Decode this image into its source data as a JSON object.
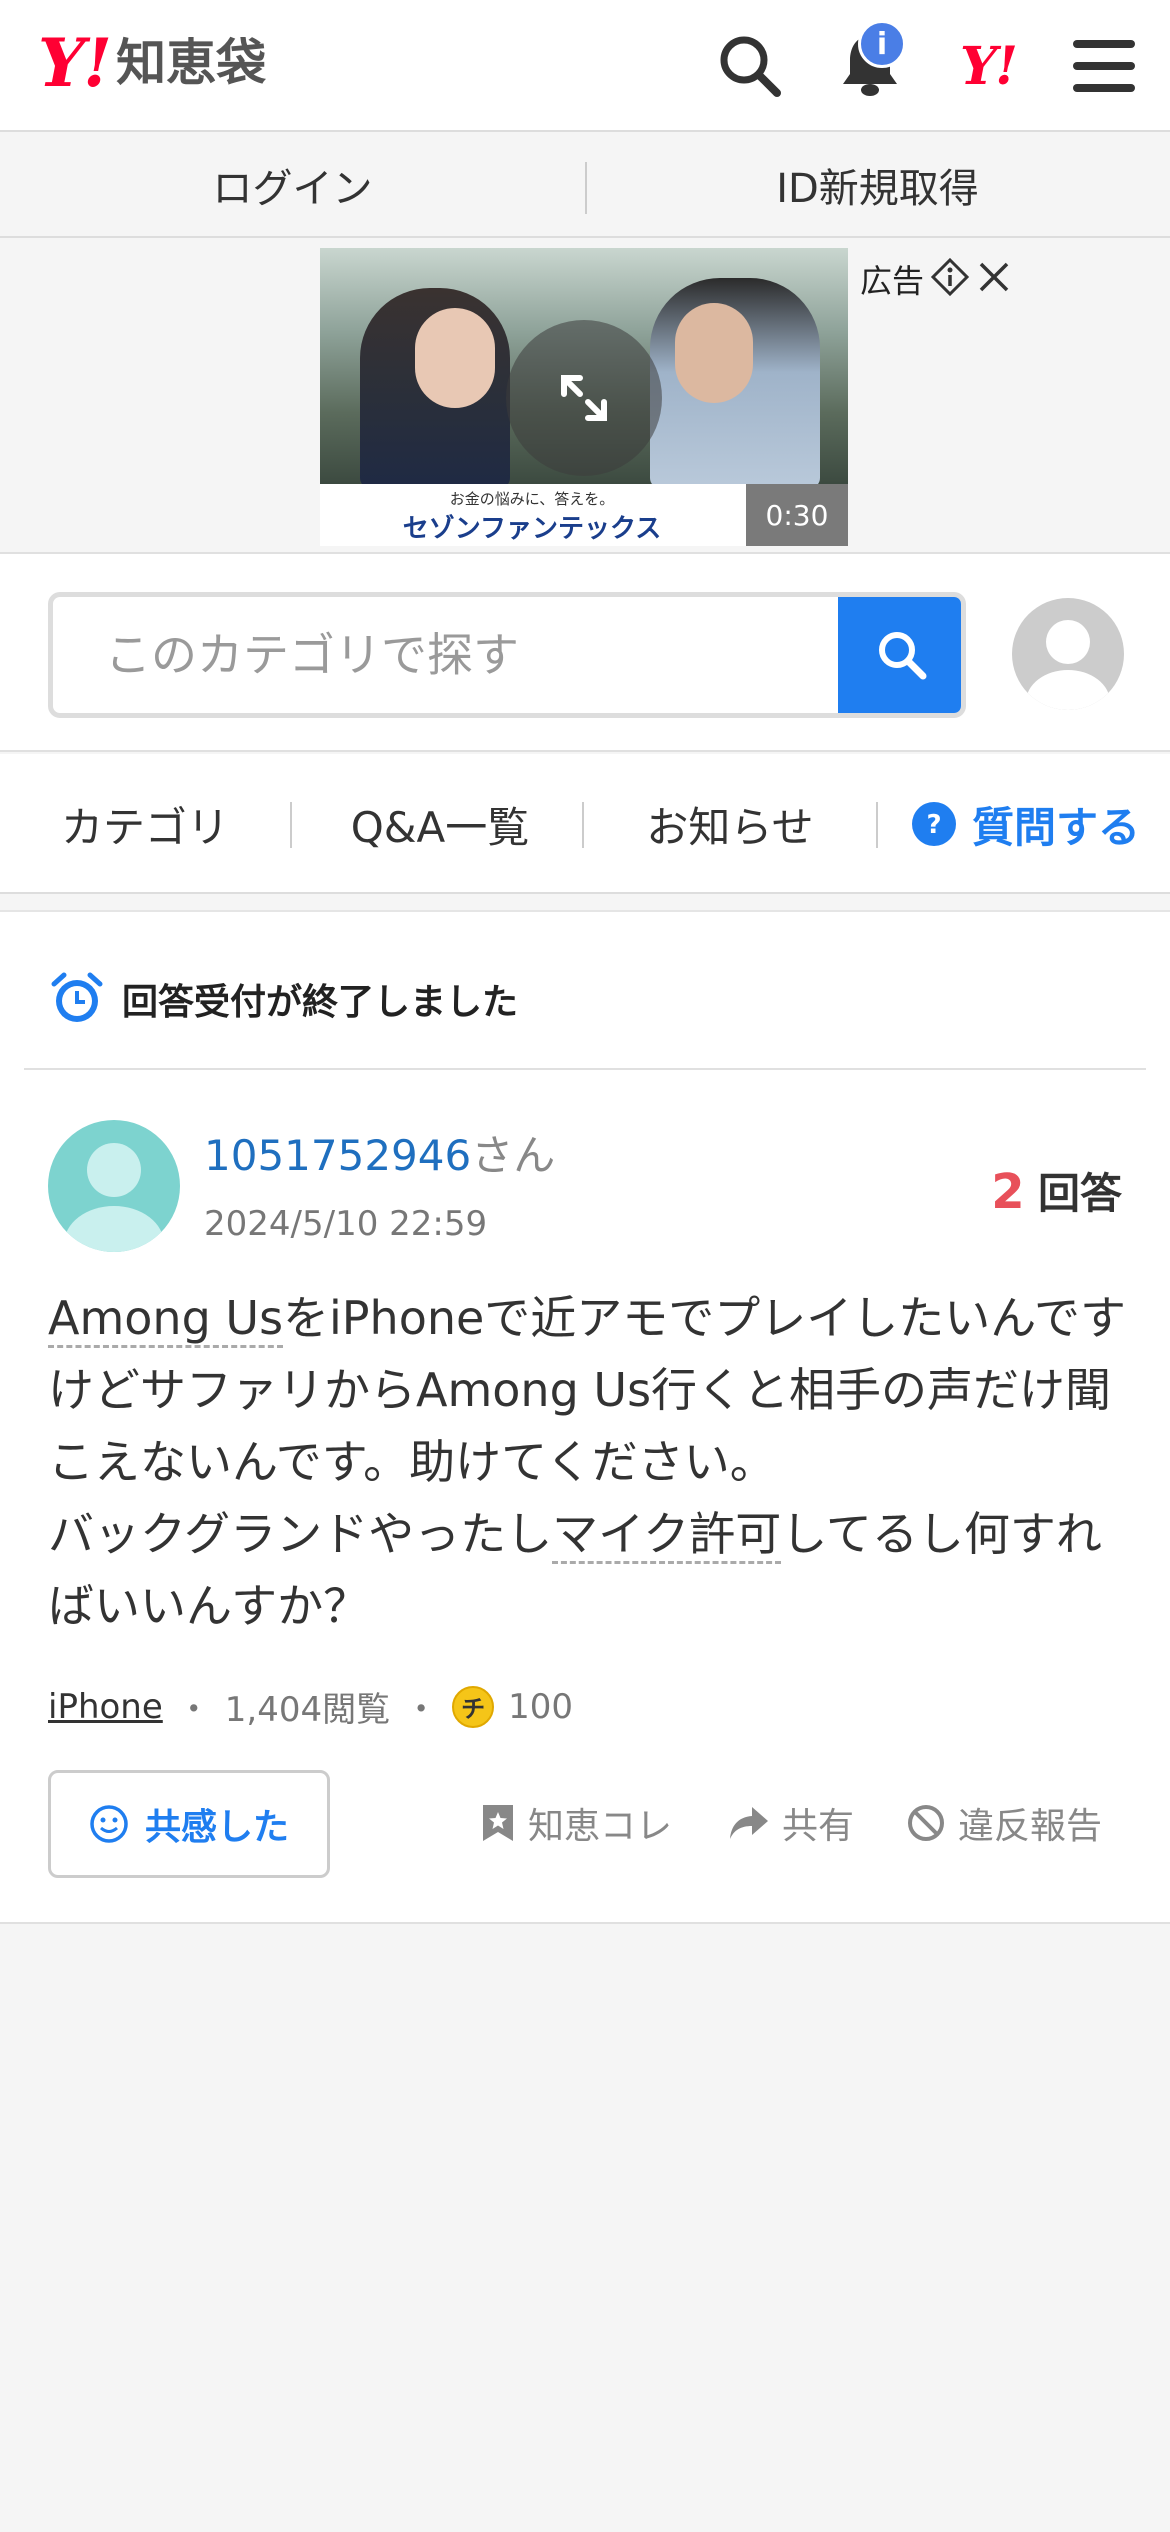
{
  "header": {
    "logo_mark": "Y!",
    "logo_text": "知恵袋",
    "notification_badge": "i",
    "yj_mark": "Y!"
  },
  "login_bar": {
    "login": "ログイン",
    "signup": "ID新規取得"
  },
  "ad": {
    "label": "広告",
    "duration": "0:30",
    "tagline": "お金の悩みに、答えを。",
    "brand": "セゾンファンテックス"
  },
  "search": {
    "placeholder": "このカテゴリで探す"
  },
  "nav": {
    "category": "カテゴリ",
    "qa_list": "Q&A一覧",
    "news": "お知らせ",
    "ask": "質問する"
  },
  "question": {
    "status": "回答受付が終了しました",
    "user_id": "1051752946",
    "user_suffix": "さん",
    "date": "2024/5/10 22:59",
    "answer_count": "2",
    "answer_label": "回答",
    "body_part1": "Among Us",
    "body_part2": "をiPhoneで近アモでプレイしたいんですけどサファリからAmong Us行くと相手の声だけ聞こえないんです。助けてください。",
    "body_part3": "バックグランドやったし",
    "body_part4": "マイク許可",
    "body_part5": "してるし何すればいいんすか？",
    "tag": "iPhone",
    "views": "1,404閲覧",
    "coin_mark": "チ",
    "coins": "100",
    "empathy_button": "共感した",
    "bookmark": "知恵コレ",
    "share": "共有",
    "report": "違反報告"
  },
  "colors": {
    "brand_red": "#ff0033",
    "accent_blue": "#1f7ef0",
    "answer_red": "#e8505a",
    "user_link": "#1f6fbf"
  }
}
